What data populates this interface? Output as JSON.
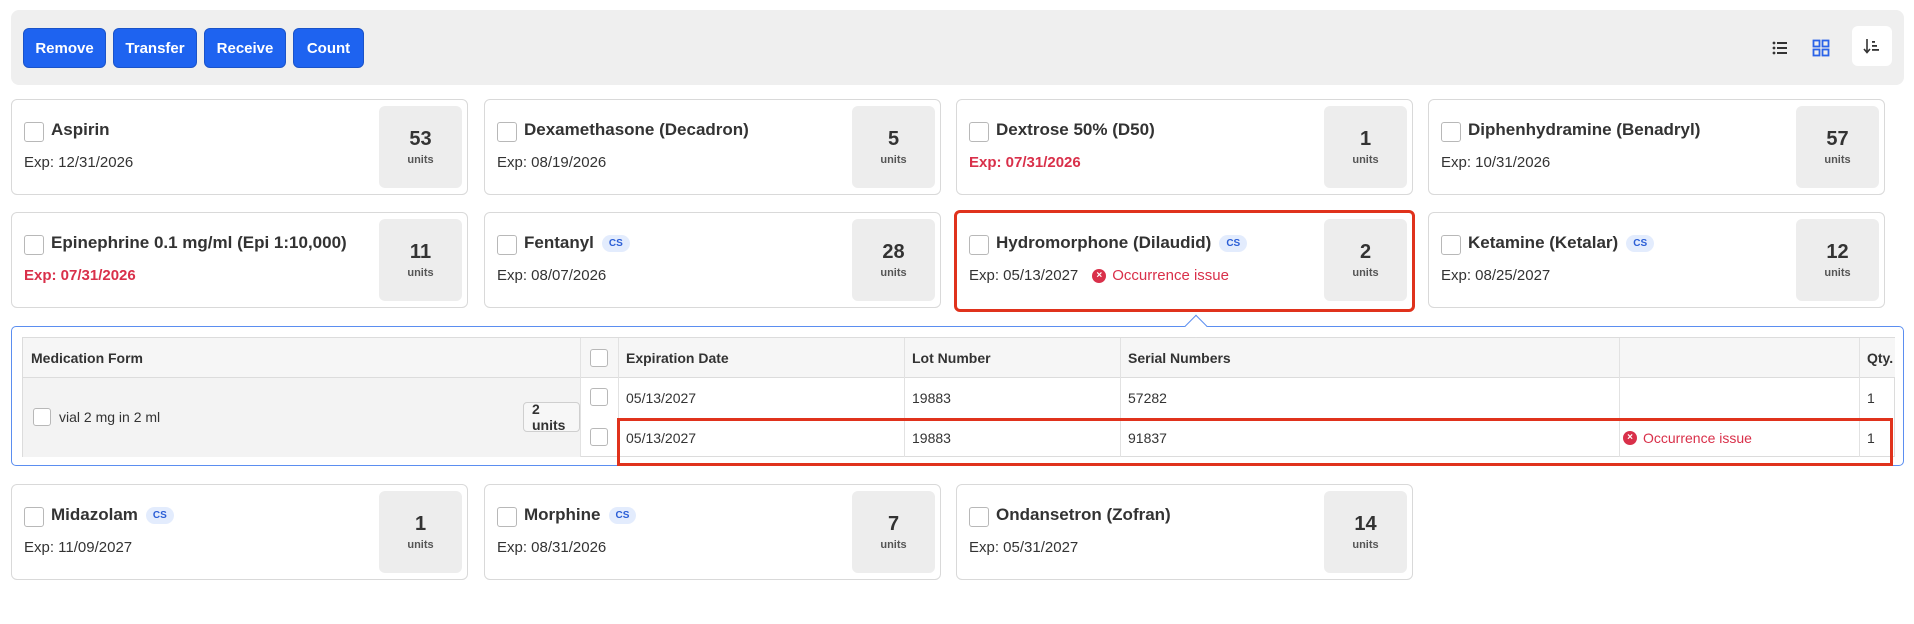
{
  "toolbar": {
    "buttons": [
      "Remove",
      "Transfer",
      "Receive",
      "Count"
    ]
  },
  "cards": [
    {
      "name": "Aspirin",
      "cs": "",
      "exp": "Exp: 12/31/2026",
      "expired": false,
      "issue": "",
      "qty": "53",
      "unit": "units"
    },
    {
      "name": "Dexamethasone (Decadron)",
      "cs": "",
      "exp": "Exp: 08/19/2026",
      "expired": false,
      "issue": "",
      "qty": "5",
      "unit": "units"
    },
    {
      "name": "Dextrose 50% (D50)",
      "cs": "",
      "exp": "Exp: 07/31/2026",
      "expired": true,
      "issue": "",
      "qty": "1",
      "unit": "units"
    },
    {
      "name": "Diphenhydramine (Benadryl)",
      "cs": "",
      "exp": "Exp: 10/31/2026",
      "expired": false,
      "issue": "",
      "qty": "57",
      "unit": "units"
    },
    {
      "name": "Epinephrine 0.1 mg/ml (Epi 1:10,000)",
      "cs": "",
      "exp": "Exp: 07/31/2026",
      "expired": true,
      "issue": "",
      "qty": "11",
      "unit": "units"
    },
    {
      "name": "Fentanyl",
      "cs": "CS",
      "exp": "Exp: 08/07/2026",
      "expired": false,
      "issue": "",
      "qty": "28",
      "unit": "units"
    },
    {
      "name": "Hydromorphone (Dilaudid)",
      "cs": "CS",
      "exp": "Exp: 05/13/2027",
      "expired": false,
      "issue": "Occurrence issue",
      "qty": "2",
      "unit": "units"
    },
    {
      "name": "Ketamine (Ketalar)",
      "cs": "CS",
      "exp": "Exp: 08/25/2027",
      "expired": false,
      "issue": "",
      "qty": "12",
      "unit": "units"
    },
    {
      "name": "Midazolam",
      "cs": "CS",
      "exp": "Exp: 11/09/2027",
      "expired": false,
      "issue": "",
      "qty": "1",
      "unit": "units"
    },
    {
      "name": "Morphine",
      "cs": "CS",
      "exp": "Exp: 08/31/2026",
      "expired": false,
      "issue": "",
      "qty": "7",
      "unit": "units"
    },
    {
      "name": "Ondansetron (Zofran)",
      "cs": "",
      "exp": "Exp: 05/31/2027",
      "expired": false,
      "issue": "",
      "qty": "14",
      "unit": "units"
    }
  ],
  "detail": {
    "headers": {
      "form": "Medication Form",
      "expiration": "Expiration Date",
      "lot": "Lot Number",
      "serial": "Serial Numbers",
      "qty": "Qty."
    },
    "form_label": "vial 2 mg in 2 ml",
    "form_units": "2 units",
    "rows": [
      {
        "expiration": "05/13/2027",
        "lot": "19883",
        "serial": "57282",
        "issue": "",
        "qty": "1"
      },
      {
        "expiration": "05/13/2027",
        "lot": "19883",
        "serial": "91837",
        "issue": "Occurrence issue",
        "qty": "1"
      }
    ]
  }
}
